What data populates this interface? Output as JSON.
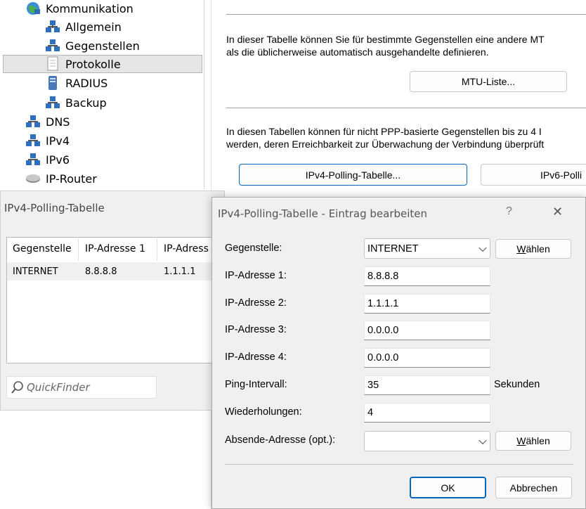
{
  "tree": {
    "items": [
      {
        "label": "Kommunikation",
        "icon": "network-globe-icon"
      },
      {
        "label": "Allgemein",
        "icon": "network-icon"
      },
      {
        "label": "Gegenstellen",
        "icon": "network-icon"
      },
      {
        "label": "Protokolle",
        "icon": "document-icon"
      },
      {
        "label": "RADIUS",
        "icon": "server-icon"
      },
      {
        "label": "Backup",
        "icon": "network-icon"
      },
      {
        "label": "DNS",
        "icon": "network-icon"
      },
      {
        "label": "IPv4",
        "icon": "network-icon"
      },
      {
        "label": "IPv6",
        "icon": "network-icon"
      },
      {
        "label": "IP-Router",
        "icon": "router-icon"
      }
    ]
  },
  "panel": {
    "mtu_text_1": "In dieser Tabelle können Sie für bestimmte Gegenstellen eine andere MT",
    "mtu_text_2": "als die üblicherweise automatisch ausgehandelte definieren.",
    "mtu_button": "MTU-Liste...",
    "poll_text_1": "In diesen Tabellen können für nicht PPP-basierte Gegenstellen bis zu 4 I",
    "poll_text_2": "werden, deren Erreichbarkeit zur Überwachung der Verbindung überprüft",
    "ipv4_button": "IPv4-Polling-Tabelle...",
    "ipv6_button": "IPv6-Polli"
  },
  "polling_window": {
    "title": "IPv4-Polling-Tabelle",
    "columns": [
      "Gegenstelle",
      "IP-Adresse 1",
      "IP-Adress"
    ],
    "rows": [
      {
        "gegenstelle": "INTERNET",
        "ip1": "8.8.8.8",
        "ip2": "1.1.1.1"
      }
    ],
    "quickfinder_placeholder": "QuickFinder"
  },
  "dialog": {
    "title": "IPv4-Polling-Tabelle - Eintrag bearbeiten",
    "help": "?",
    "close": "✕",
    "fields": {
      "gegenstelle": {
        "label": "Gegenstelle:",
        "value": "INTERNET"
      },
      "ip1": {
        "label": "IP-Adresse 1:",
        "value": "8.8.8.8"
      },
      "ip2": {
        "label": "IP-Adresse 2:",
        "value": "1.1.1.1"
      },
      "ip3": {
        "label": "IP-Adresse 3:",
        "value": "0.0.0.0"
      },
      "ip4": {
        "label": "IP-Adresse 4:",
        "value": "0.0.0.0"
      },
      "ping": {
        "label": "Ping-Intervall:",
        "value": "35",
        "unit": "Sekunden"
      },
      "retries": {
        "label": "Wiederholungen:",
        "value": "4"
      },
      "source": {
        "label": "Absende-Adresse (opt.):",
        "value": ""
      }
    },
    "choose_label_underlined": "W",
    "choose_label_rest": "ählen",
    "ok": "OK",
    "cancel": "Abbrechen"
  },
  "colors": {
    "accent": "#0067c0",
    "selected_bg": "#e5e5e5",
    "window_bg": "#f0f0f0"
  }
}
